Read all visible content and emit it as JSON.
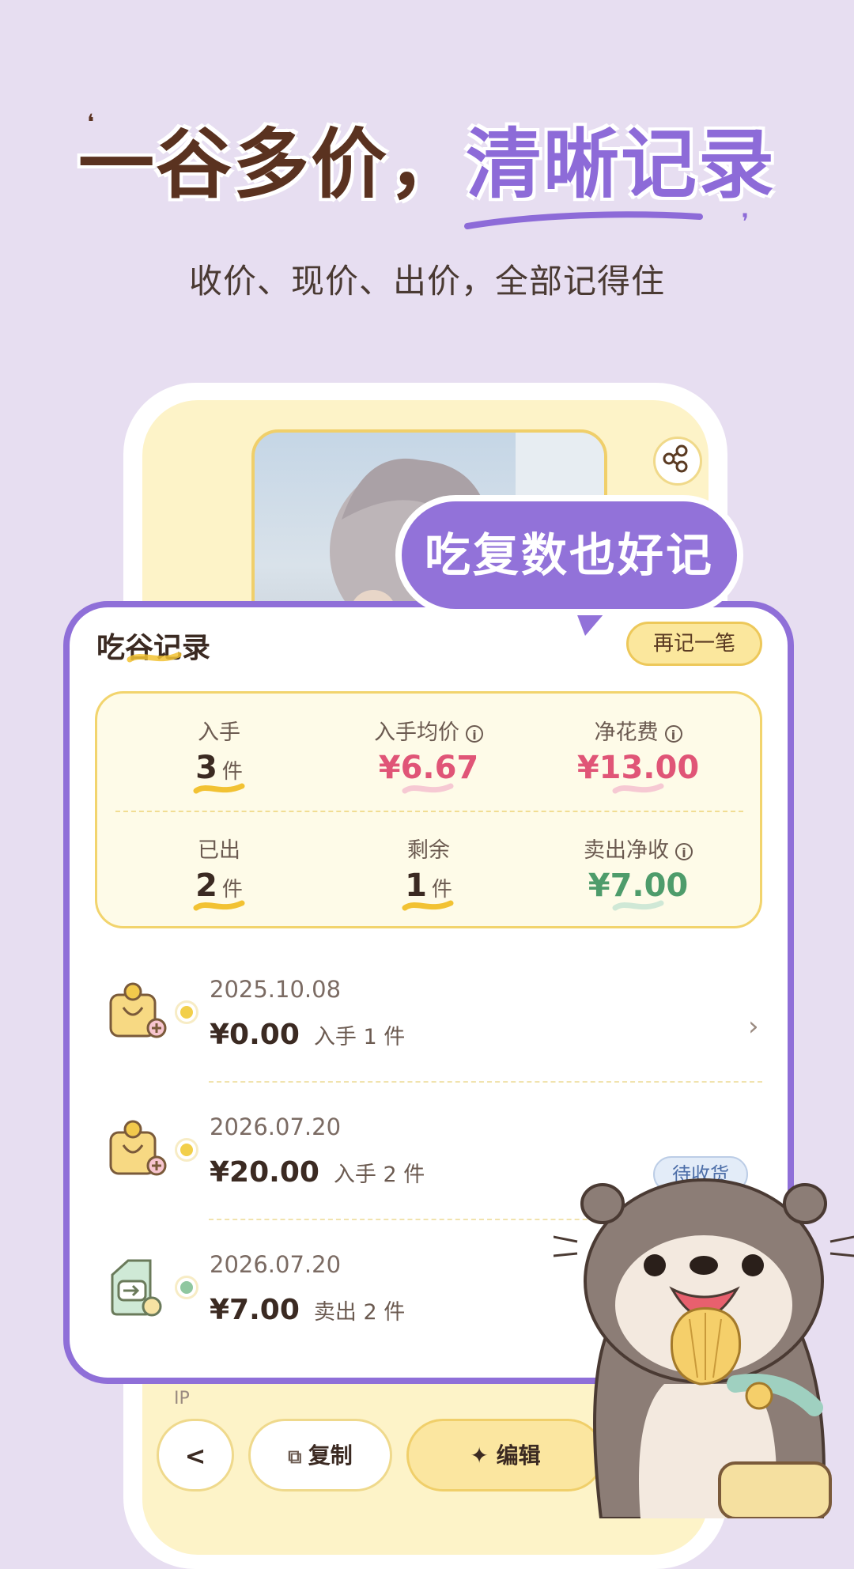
{
  "headline": {
    "part1": "一谷多价，",
    "part2": "清晰记录",
    "subtitle": "收价、现价、出价，全部记得住"
  },
  "bubble": {
    "text": "吃复数也好记"
  },
  "card": {
    "title": "吃谷记录",
    "again_button": "再记一笔",
    "stats": {
      "acquired": {
        "label": "入手",
        "value": "3",
        "unit": "件"
      },
      "avg_price": {
        "label": "入手均价",
        "value": "¥6.67"
      },
      "net_cost": {
        "label": "净花费",
        "value": "¥13.00"
      },
      "sold": {
        "label": "已出",
        "value": "2",
        "unit": "件"
      },
      "remaining": {
        "label": "剩余",
        "value": "1",
        "unit": "件"
      },
      "net_income": {
        "label": "卖出净收",
        "value": "¥7.00"
      }
    },
    "records": [
      {
        "date": "2025.10.08",
        "amount": "¥0.00",
        "desc": "入手 1 件",
        "type": "buy",
        "dot_color": "#f2cf4a"
      },
      {
        "date": "2026.07.20",
        "amount": "¥20.00",
        "desc": "入手 2 件",
        "type": "buy",
        "dot_color": "#f2cf4a",
        "status": "待收货"
      },
      {
        "date": "2026.07.20",
        "amount": "¥7.00",
        "desc": "卖出 2 件",
        "type": "sell",
        "dot_color": "#8fc7a0"
      }
    ]
  },
  "phone": {
    "ip_label": "IP",
    "back_button": "<",
    "copy_button": "复制",
    "edit_button": "编辑"
  },
  "colors": {
    "background": "#e7def1",
    "accent_purple": "#8f6fd8",
    "cream": "#fdf3c8",
    "price_red": "#e05577",
    "income_green": "#4e9c6b"
  },
  "icons": [
    "share-icon",
    "info-icon",
    "shopping-bag-add-icon",
    "sell-tag-icon",
    "chevron-right-icon",
    "copy-icon",
    "sparkle-icon"
  ]
}
